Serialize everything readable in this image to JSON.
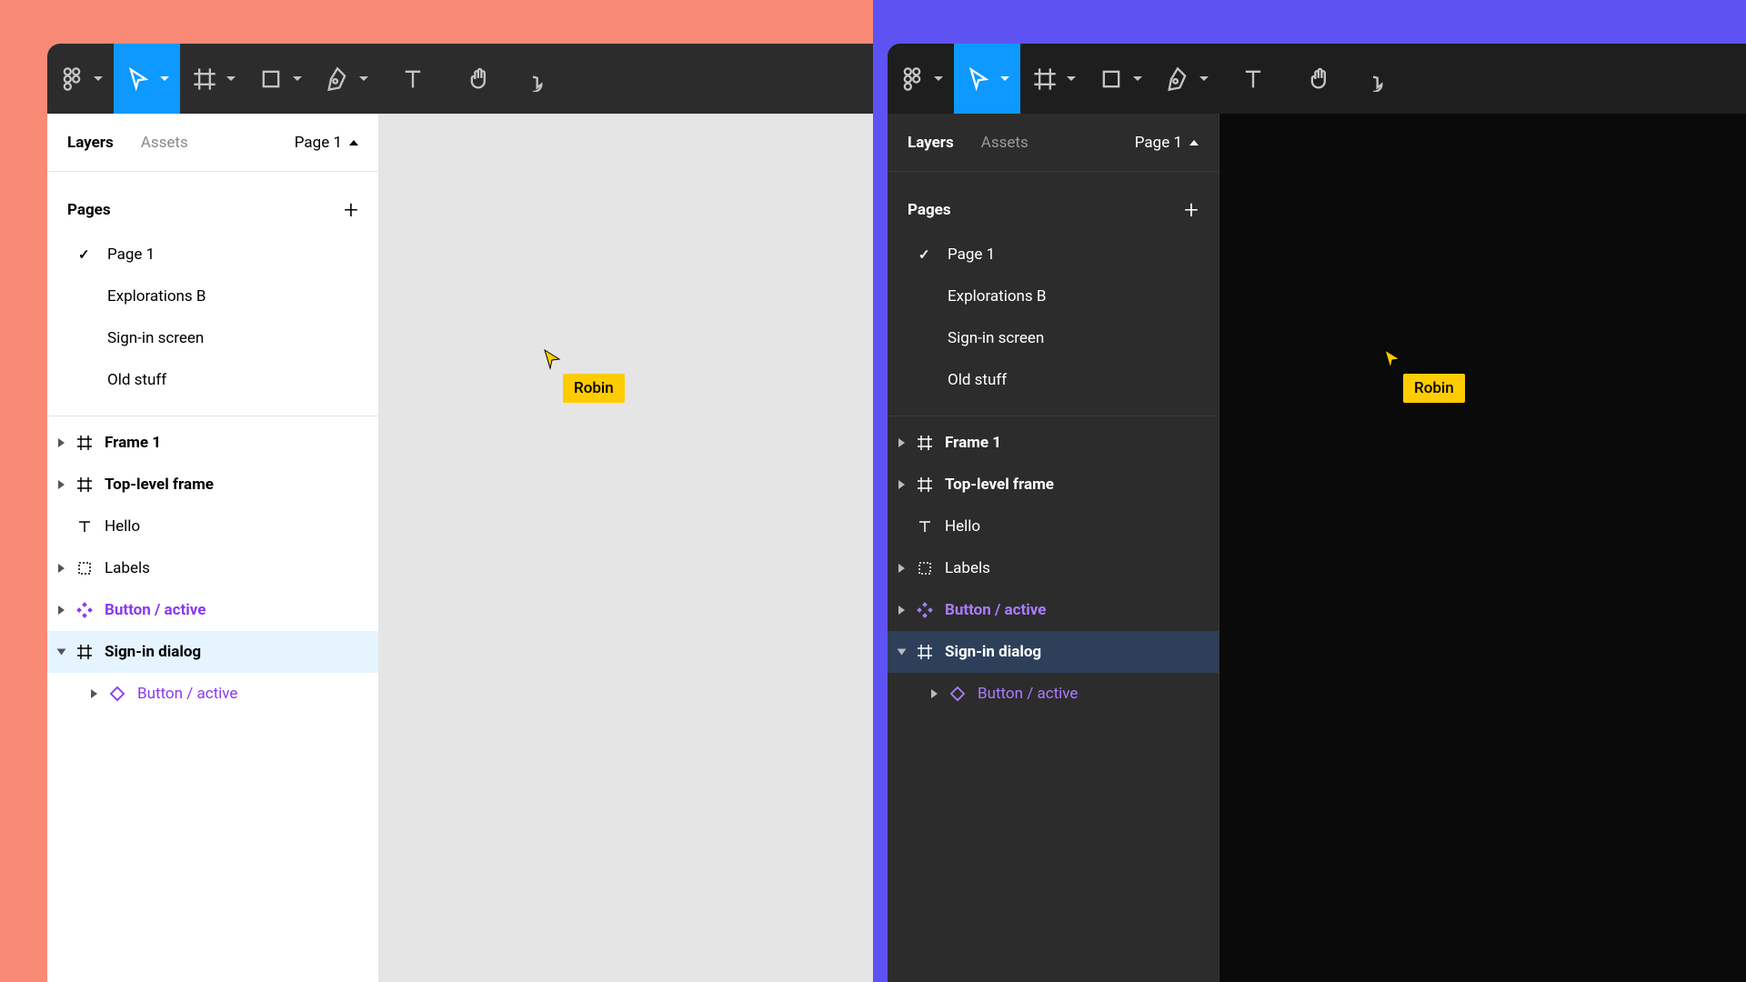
{
  "themes": [
    "light",
    "dark"
  ],
  "toolbar": {
    "tools": [
      {
        "id": "figma-menu",
        "caret": true,
        "active": false
      },
      {
        "id": "move-tool",
        "caret": true,
        "active": true
      },
      {
        "id": "frame-tool",
        "caret": true,
        "active": false
      },
      {
        "id": "shape-tool",
        "caret": true,
        "active": false
      },
      {
        "id": "pen-tool",
        "caret": true,
        "active": false
      },
      {
        "id": "text-tool",
        "caret": false,
        "active": false
      },
      {
        "id": "hand-tool",
        "caret": false,
        "active": false
      },
      {
        "id": "comment-tool",
        "caret": false,
        "active": false
      }
    ]
  },
  "sidebar": {
    "tabs": {
      "layers": "Layers",
      "assets": "Assets",
      "active": "layers"
    },
    "page_selector": "Page 1",
    "pages_header": "Pages",
    "pages": [
      {
        "name": "Page 1",
        "current": true
      },
      {
        "name": "Explorations B",
        "current": false
      },
      {
        "name": "Sign-in screen",
        "current": false
      },
      {
        "name": "Old stuff",
        "current": false
      }
    ],
    "layers": [
      {
        "name": "Frame 1",
        "icon": "frame",
        "expand": "collapsed",
        "bold": true
      },
      {
        "name": "Top-level frame",
        "icon": "frame",
        "expand": "collapsed",
        "bold": true
      },
      {
        "name": "Hello",
        "icon": "text",
        "expand": "none",
        "bold": false
      },
      {
        "name": "Labels",
        "icon": "group",
        "expand": "collapsed",
        "bold": false
      },
      {
        "name": "Button / active",
        "icon": "component",
        "expand": "collapsed",
        "bold": true,
        "variant": "component"
      },
      {
        "name": "Sign-in dialog",
        "icon": "frame",
        "expand": "expanded",
        "bold": true,
        "selected": true
      },
      {
        "name": "Button / active",
        "icon": "instance",
        "expand": "collapsed",
        "bold": false,
        "variant": "instance",
        "indent": 1
      }
    ]
  },
  "collaborator": {
    "name": "Robin",
    "color": "#FFCC00"
  }
}
